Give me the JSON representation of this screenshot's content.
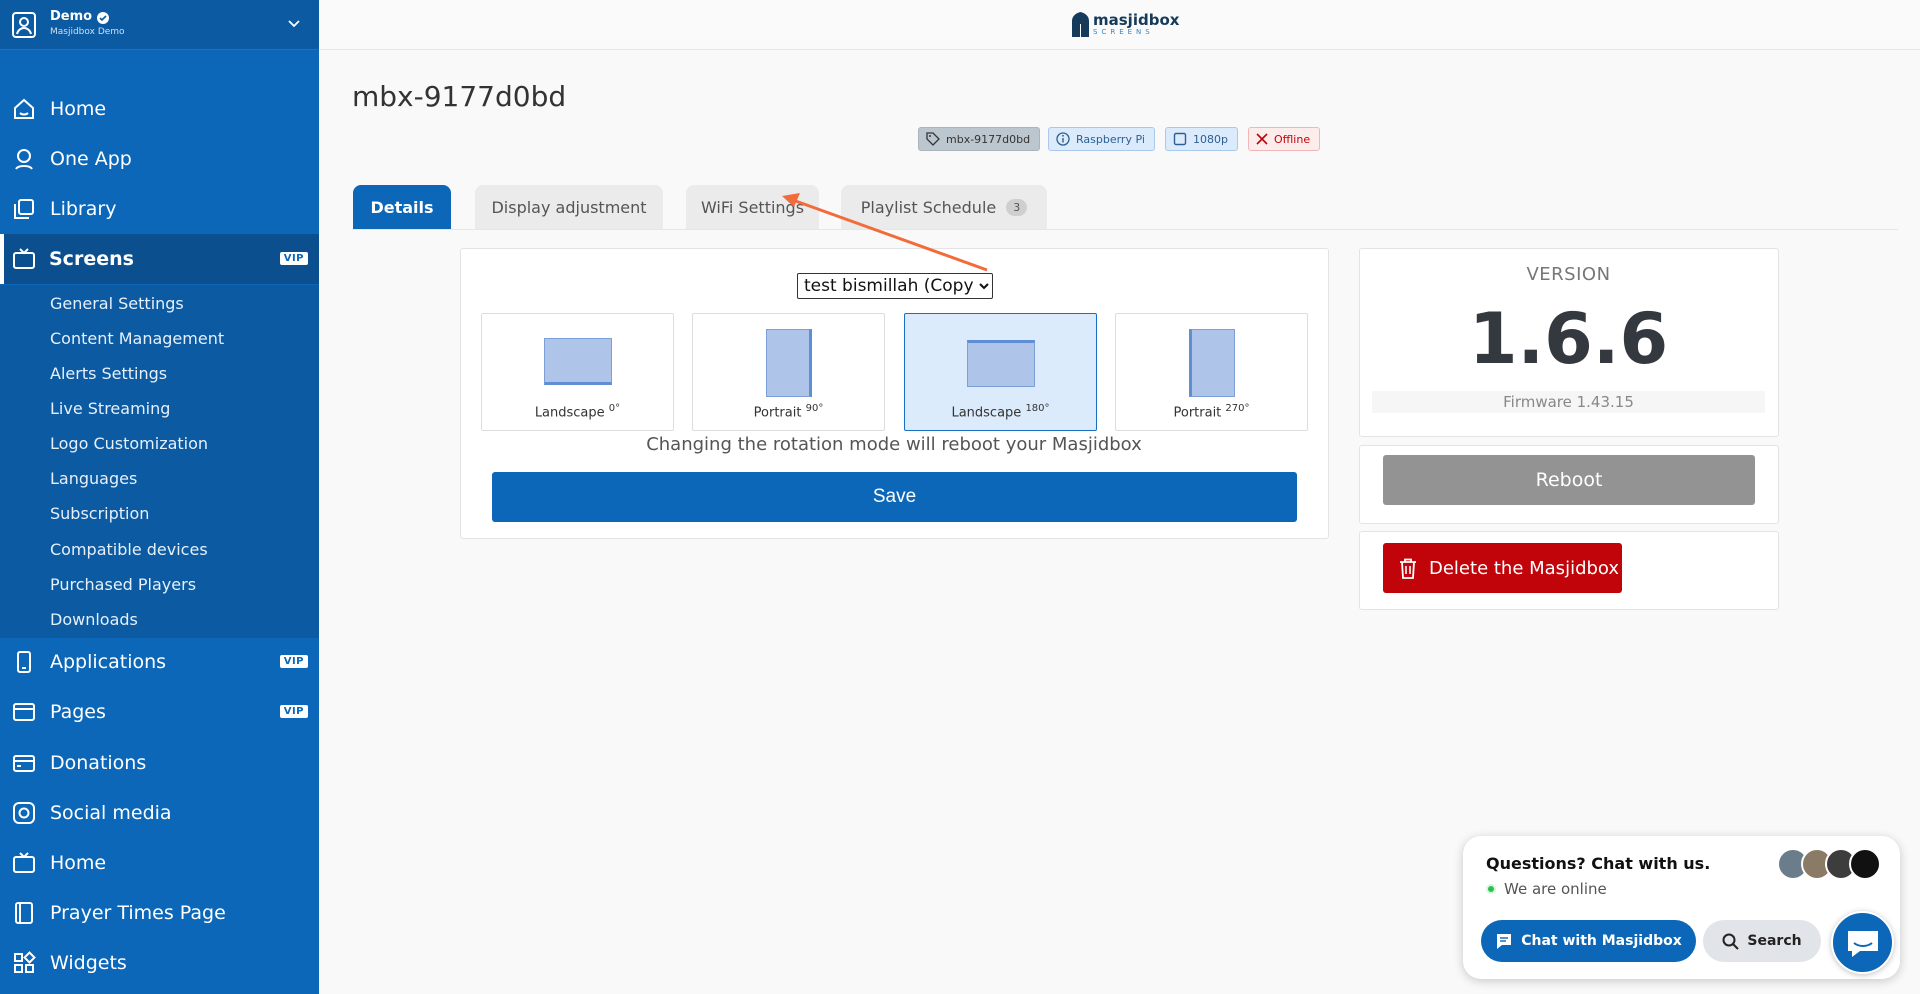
{
  "account": {
    "name": "Demo",
    "subtitle": "Masjidbox Demo"
  },
  "sidebar": {
    "items": [
      {
        "label": "Home",
        "icon": "home-icon"
      },
      {
        "label": "One App",
        "icon": "app-icon"
      },
      {
        "label": "Library",
        "icon": "library-icon"
      },
      {
        "label": "Screens",
        "icon": "tv-icon",
        "vip": "VIP"
      },
      {
        "label": "Applications",
        "icon": "phone-icon",
        "vip": "VIP"
      },
      {
        "label": "Pages",
        "icon": "browser-icon",
        "vip": "VIP"
      },
      {
        "label": "Donations",
        "icon": "wallet-icon"
      },
      {
        "label": "Social media",
        "icon": "instagram-icon"
      },
      {
        "label": "Home",
        "icon": "tv-icon"
      },
      {
        "label": "Prayer Times Page",
        "icon": "book-icon"
      },
      {
        "label": "Widgets",
        "icon": "widgets-icon"
      }
    ],
    "sub_items": [
      "General Settings",
      "Content Management",
      "Alerts Settings",
      "Live Streaming",
      "Logo Customization",
      "Languages",
      "Subscription",
      "Compatible devices",
      "Purchased Players",
      "Downloads"
    ]
  },
  "logo": {
    "name": "masjidbox",
    "tagline": "SCREENS"
  },
  "page": {
    "title": "mbx-9177d0bd"
  },
  "badges": [
    {
      "label": "mbx-9177d0bd"
    },
    {
      "label": "Raspberry Pi"
    },
    {
      "label": "1080p"
    },
    {
      "label": "Offline"
    }
  ],
  "tabs": [
    {
      "label": "Details"
    },
    {
      "label": "Display adjustment"
    },
    {
      "label": "WiFi Settings"
    },
    {
      "label": "Playlist Schedule",
      "count": "3"
    }
  ],
  "playlist_select": {
    "value": "test bismillah (Copy)"
  },
  "rotation": {
    "options": [
      {
        "label": "Landscape",
        "degrees": "0°"
      },
      {
        "label": "Portrait",
        "degrees": "90°"
      },
      {
        "label": "Landscape",
        "degrees": "180°"
      },
      {
        "label": "Portrait",
        "degrees": "270°"
      }
    ],
    "selected": "Landscape 180°",
    "warning": "Changing the rotation mode will reboot your Masjidbox",
    "save_label": "Save"
  },
  "version": {
    "label": "VERSION",
    "number": "1.6.6",
    "firmware": "Firmware 1.43.15"
  },
  "actions": {
    "reboot_label": "Reboot",
    "delete_label": "Delete the Masjidbox"
  },
  "chat": {
    "question": "Questions? Chat with us.",
    "status": "We are online",
    "chat_button": "Chat with Masjidbox",
    "search_button": "Search"
  },
  "colors": {
    "primary": "#0c67b8",
    "danger": "#c0040a",
    "annotation_arrow": "#f26b3a"
  }
}
